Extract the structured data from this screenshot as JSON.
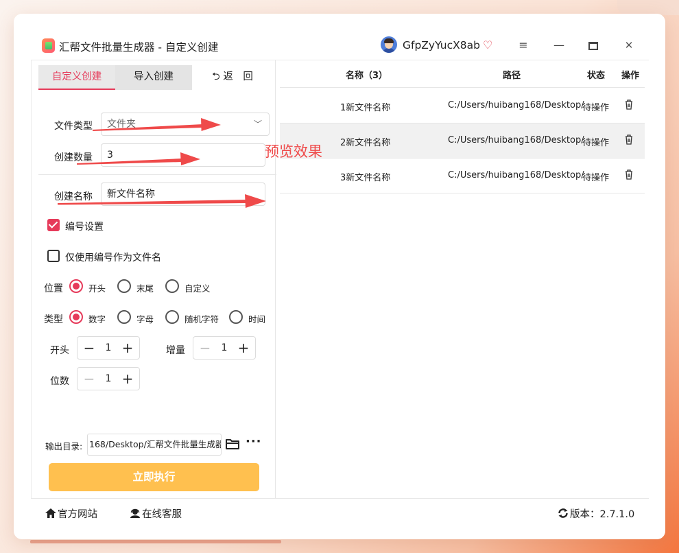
{
  "window": {
    "title": "汇帮文件批量生成器 - 自定义创建",
    "username": "GfpZyYucX8ab",
    "controls": {
      "menu": "≡",
      "minimize": "—",
      "close": "✕"
    }
  },
  "tabs": [
    {
      "label": "自定义创建",
      "active": true
    },
    {
      "label": "导入创建",
      "active": false
    },
    {
      "label": "⮌ 返　回",
      "active": false
    }
  ],
  "form": {
    "file_type": {
      "label": "文件类型",
      "value": "文件夹"
    },
    "count": {
      "label": "创建数量",
      "value": "3"
    },
    "name": {
      "label": "创建名称",
      "value": "新文件名称"
    },
    "numbering": {
      "label": "编号设置",
      "checked": true
    },
    "only_number": {
      "label": "仅使用编号作为文件名",
      "checked": false
    },
    "position": {
      "label": "位置",
      "options": [
        "开头",
        "末尾",
        "自定义"
      ],
      "selected": "开头"
    },
    "type": {
      "label": "类型",
      "options": [
        "数字",
        "字母",
        "随机字符",
        "时间"
      ],
      "selected": "数字"
    },
    "start": {
      "label": "开头",
      "value": "1"
    },
    "increment": {
      "label": "增量",
      "value": "1"
    },
    "digits": {
      "label": "位数",
      "value": "1"
    },
    "output": {
      "label": "输出目录:",
      "value": "168/Desktop/汇帮文件批量生成器"
    },
    "run_label": "立即执行"
  },
  "table": {
    "headers": {
      "name": "名称（3）",
      "path": "路径",
      "status": "状态",
      "action": "操作"
    },
    "rows": [
      {
        "name": "1新文件名称",
        "path": "C:/Users/huibang168/Desktop/",
        "status": "待操作"
      },
      {
        "name": "2新文件名称",
        "path": "C:/Users/huibang168/Desktop/",
        "status": "待操作"
      },
      {
        "name": "3新文件名称",
        "path": "C:/Users/huibang168/Desktop/",
        "status": "待操作"
      }
    ]
  },
  "annotation": {
    "text": "预览效果",
    "color": "#ef4a4a"
  },
  "footer": {
    "website": "官方网站",
    "service": "在线客服",
    "version": "版本：2.7.1.0"
  },
  "colors": {
    "accent": "#e63a5a",
    "run_button": "#ffc04f",
    "arrow": "#ef4a4a"
  }
}
